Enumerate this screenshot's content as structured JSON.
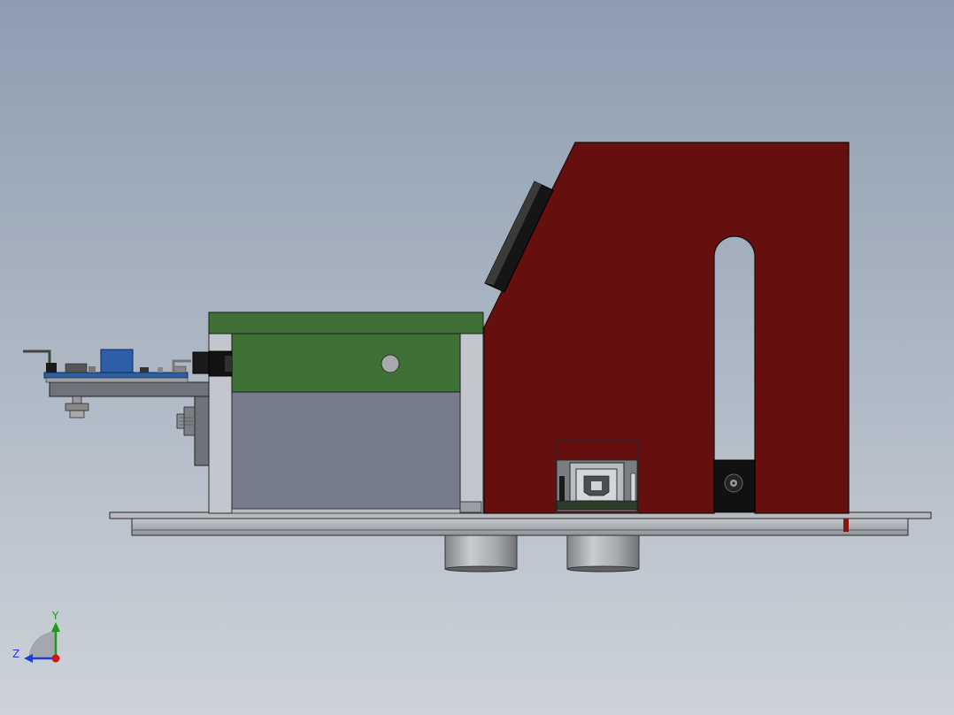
{
  "viewport": {
    "background_top": "#8d9db0",
    "background_bottom": "#cdd2d8"
  },
  "colors": {
    "bracket_red": "#650f0f",
    "green_board": "#3f7036",
    "gray_body": "#767c8a",
    "base_plate": "#a7acb2",
    "blue_module": "#2f5ea8",
    "black_part": "#151515"
  },
  "triad": {
    "y_label": "Y",
    "z_label": "Z",
    "y_color": "#1a9b1a",
    "z_color": "#1f3fd0",
    "x_color": "#d01515"
  }
}
